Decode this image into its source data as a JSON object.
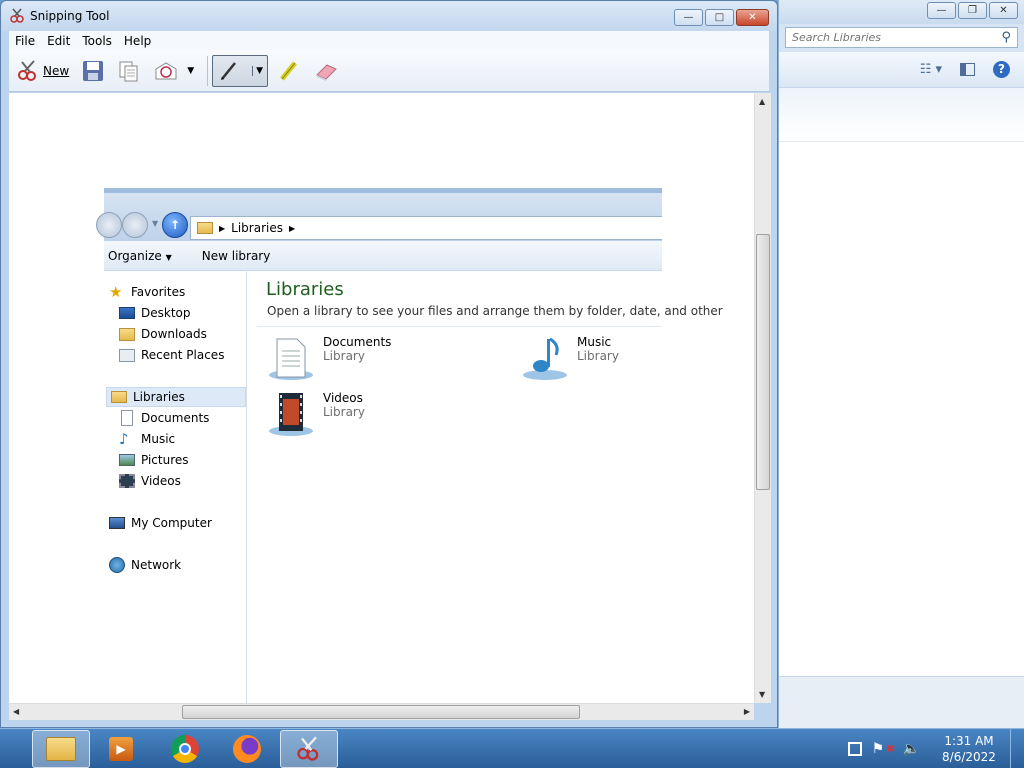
{
  "snipping_tool": {
    "title": "Snipping Tool",
    "menu": [
      "File",
      "Edit",
      "Tools",
      "Help"
    ],
    "toolbar": {
      "new_label": "New"
    }
  },
  "captured_explorer": {
    "breadcrumb": "Libraries",
    "commands": {
      "organize": "Organize",
      "new_library": "New library"
    },
    "nav": {
      "favorites": "Favorites",
      "favorites_items": [
        "Desktop",
        "Downloads",
        "Recent Places"
      ],
      "libraries": "Libraries",
      "libraries_items": [
        "Documents",
        "Music",
        "Pictures",
        "Videos"
      ],
      "computer": "My Computer",
      "network": "Network"
    },
    "content": {
      "heading": "Libraries",
      "subtitle": "Open a library to see your files and arrange them by folder, date, and other",
      "libraries": [
        {
          "name": "Documents",
          "type": "Library"
        },
        {
          "name": "Music",
          "type": "Library"
        },
        {
          "name": "Videos",
          "type": "Library"
        }
      ]
    }
  },
  "background_window": {
    "search_placeholder": "Search Libraries"
  },
  "taskbar": {
    "apps": [
      "file-explorer",
      "media-player",
      "chrome",
      "firefox",
      "snipping-tool"
    ],
    "clock": {
      "time": "1:31 AM",
      "date": "8/6/2022"
    }
  }
}
